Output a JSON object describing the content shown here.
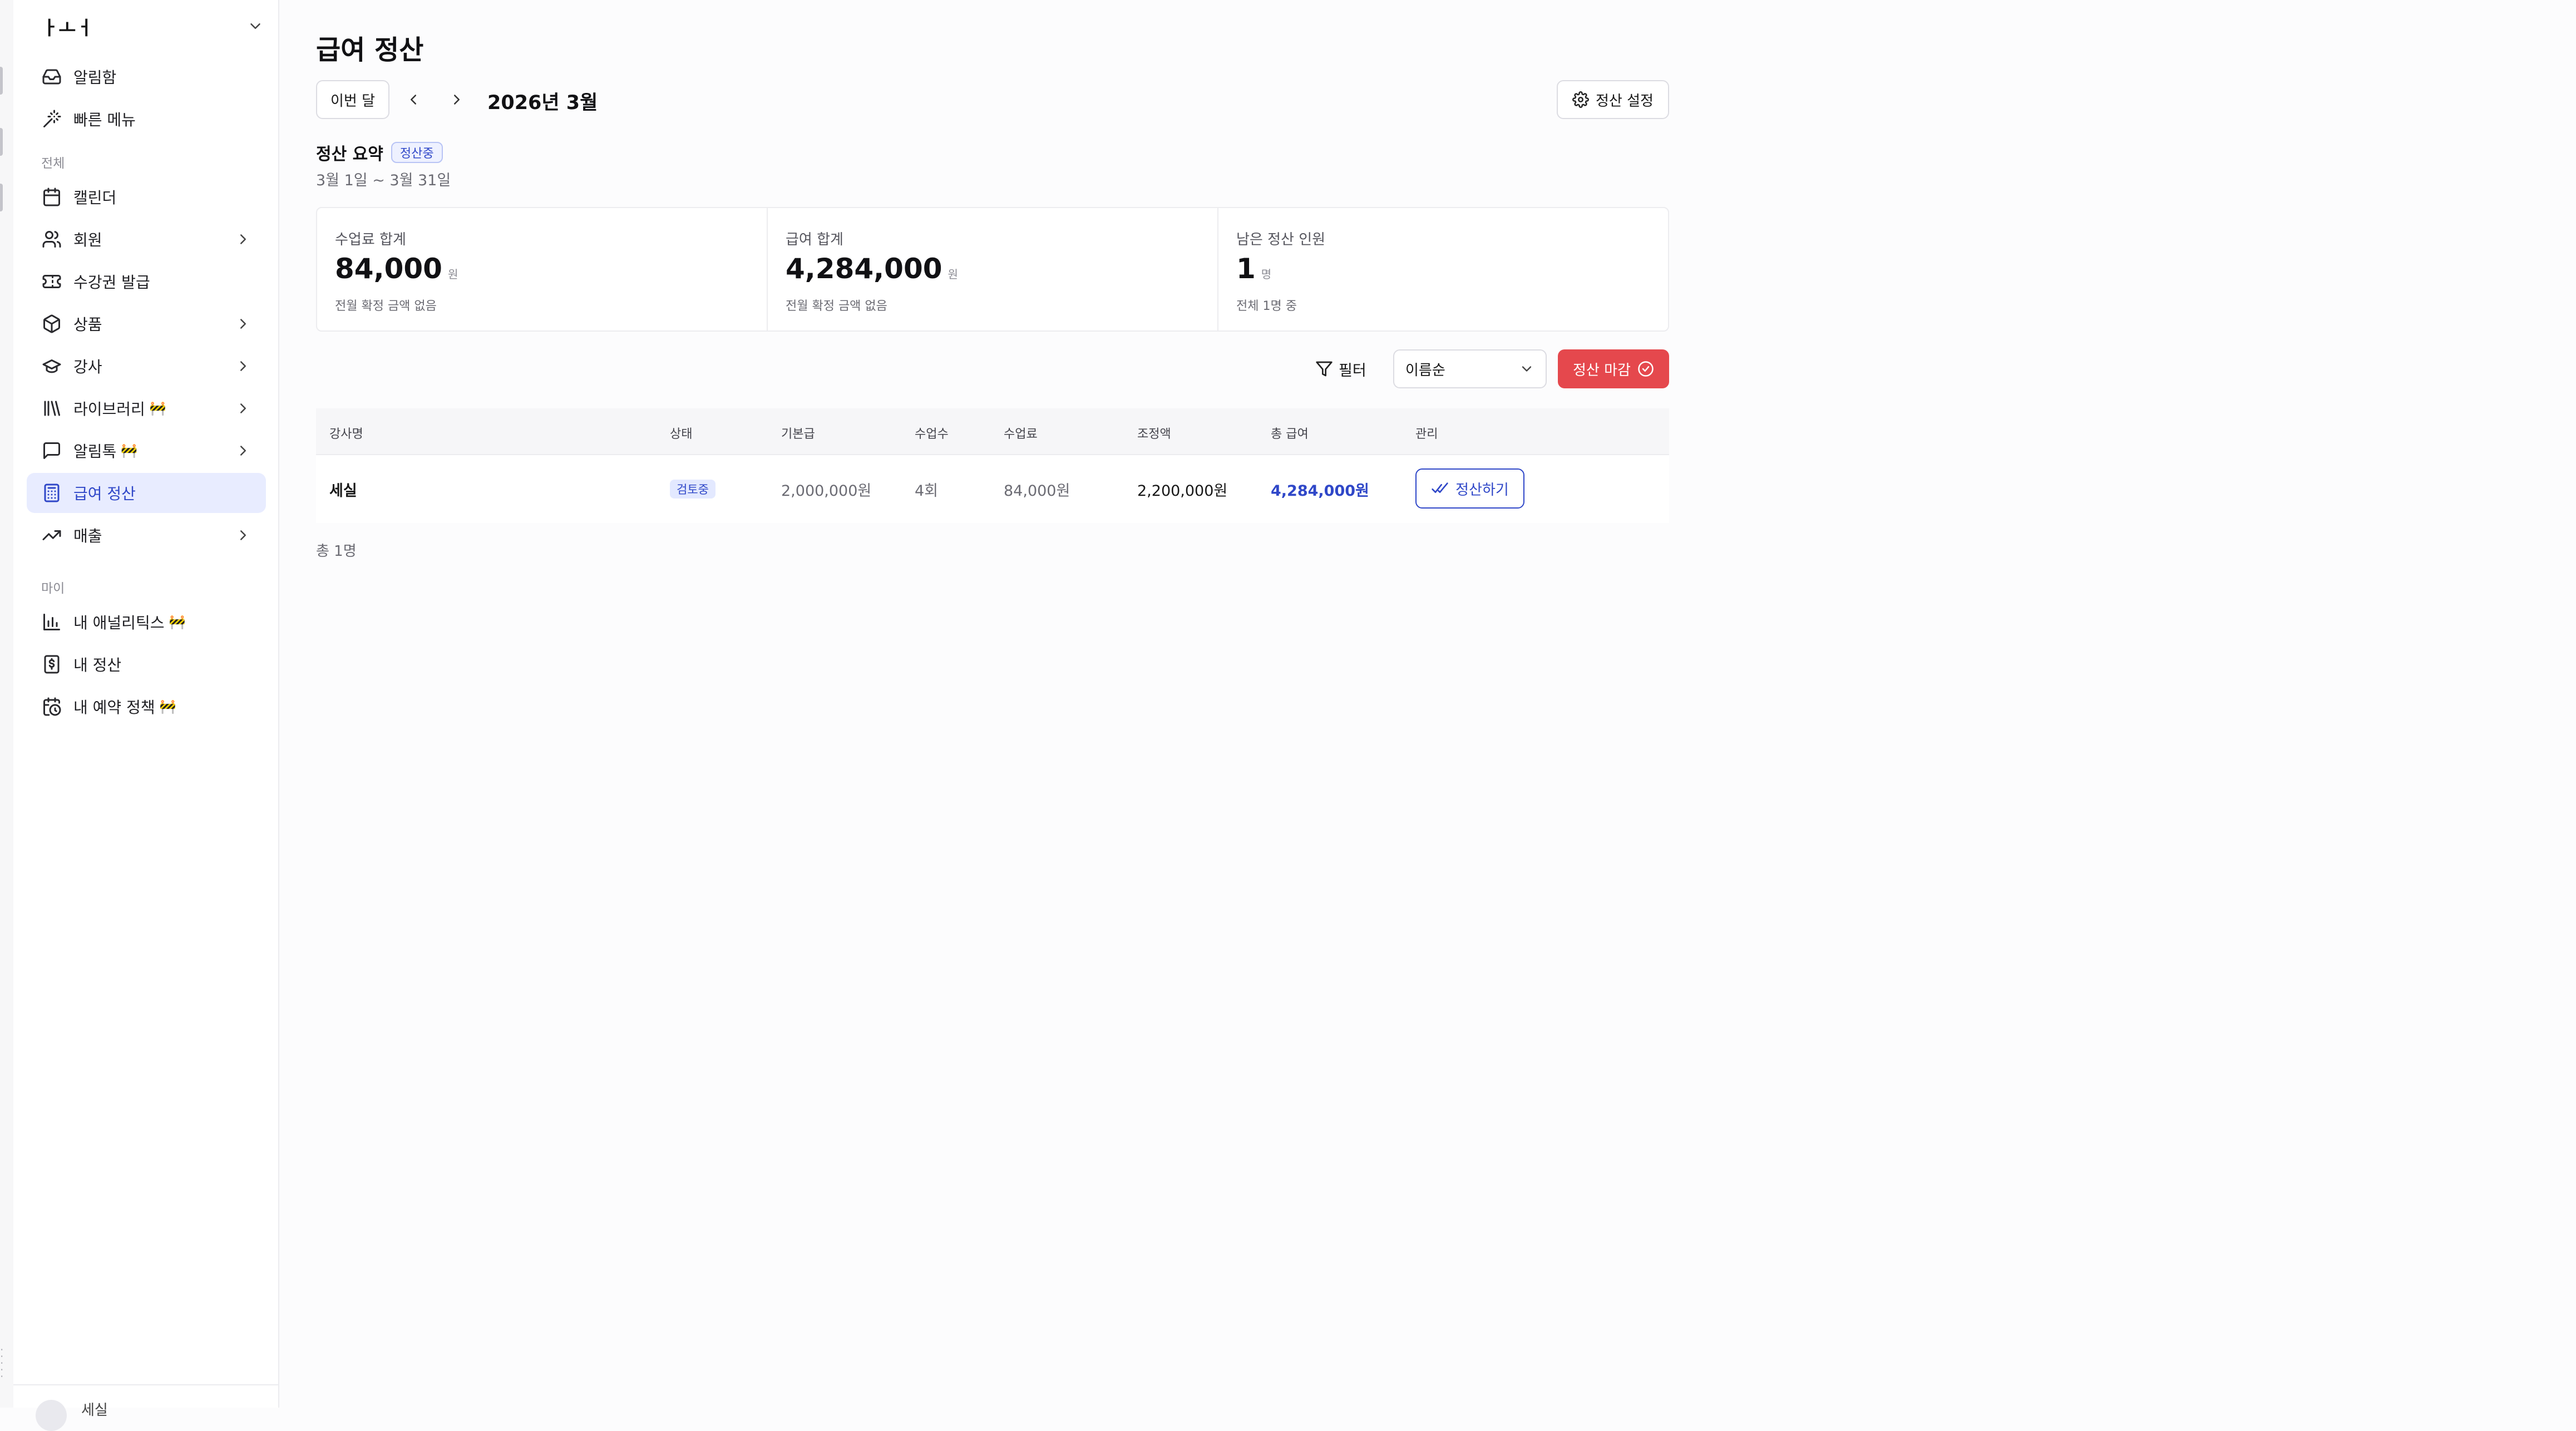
{
  "sidebar": {
    "workspace": "ㅏㅗㅓ",
    "top_items": [
      {
        "label": "알림함",
        "icon": "inbox-icon"
      },
      {
        "label": "빠른 메뉴",
        "icon": "magic-wand-icon"
      }
    ],
    "section_all": "전체",
    "all_items": [
      {
        "label": "캘린더",
        "icon": "calendar-icon",
        "has_chevron": false
      },
      {
        "label": "회원",
        "icon": "users-icon",
        "has_chevron": true
      },
      {
        "label": "수강권 발급",
        "icon": "ticket-icon",
        "has_chevron": false
      },
      {
        "label": "상품",
        "icon": "package-icon",
        "has_chevron": true
      },
      {
        "label": "강사",
        "icon": "graduation-cap-icon",
        "has_chevron": true
      },
      {
        "label": "라이브러리",
        "icon": "library-icon",
        "has_chevron": true,
        "wip": "🚧"
      },
      {
        "label": "알림톡",
        "icon": "message-icon",
        "has_chevron": true,
        "wip": "🚧"
      },
      {
        "label": "급여 정산",
        "icon": "calculator-icon",
        "has_chevron": false,
        "active": true
      },
      {
        "label": "매출",
        "icon": "trending-up-icon",
        "has_chevron": true
      }
    ],
    "section_my": "마이",
    "my_items": [
      {
        "label": "내 애널리틱스",
        "icon": "bar-chart-icon",
        "wip": "🚧"
      },
      {
        "label": "내 정산",
        "icon": "dollar-receipt-icon"
      },
      {
        "label": "내 예약 정책",
        "icon": "calendar-clock-icon",
        "wip": "🚧"
      }
    ],
    "footer_user": "세실"
  },
  "header": {
    "title": "급여 정산",
    "this_month_label": "이번 달",
    "month": "2026년 3월",
    "settings_label": "정산 설정"
  },
  "summary": {
    "title": "정산 요약",
    "status_badge": "정산중",
    "range": "3월 1일 ~ 3월 31일",
    "cards": [
      {
        "label": "수업료 합계",
        "value": "84,000",
        "unit": "원",
        "note": "전월 확정 금액 없음"
      },
      {
        "label": "급여 합계",
        "value": "4,284,000",
        "unit": "원",
        "note": "전월 확정 금액 없음"
      },
      {
        "label": "남은 정산 인원",
        "value": "1",
        "unit": "명",
        "note": "전체 1명 중"
      }
    ]
  },
  "toolbar": {
    "filter_label": "필터",
    "sort_value": "이름순",
    "close_label": "정산 마감"
  },
  "table": {
    "columns": [
      "강사명",
      "상태",
      "기본급",
      "수업수",
      "수업료",
      "조정액",
      "총 급여",
      "관리"
    ],
    "rows": [
      {
        "name": "세실",
        "status": "검토중",
        "base_pay": "2,000,000원",
        "lessons": "4회",
        "lesson_fee": "84,000원",
        "adjustment": "2,200,000원",
        "total": "4,284,000원",
        "action_label": "정산하기"
      }
    ],
    "total_count": "총 1명"
  },
  "colors": {
    "accent": "#2f47c8",
    "danger": "#e5484d",
    "active_bg": "#e8ecff"
  }
}
